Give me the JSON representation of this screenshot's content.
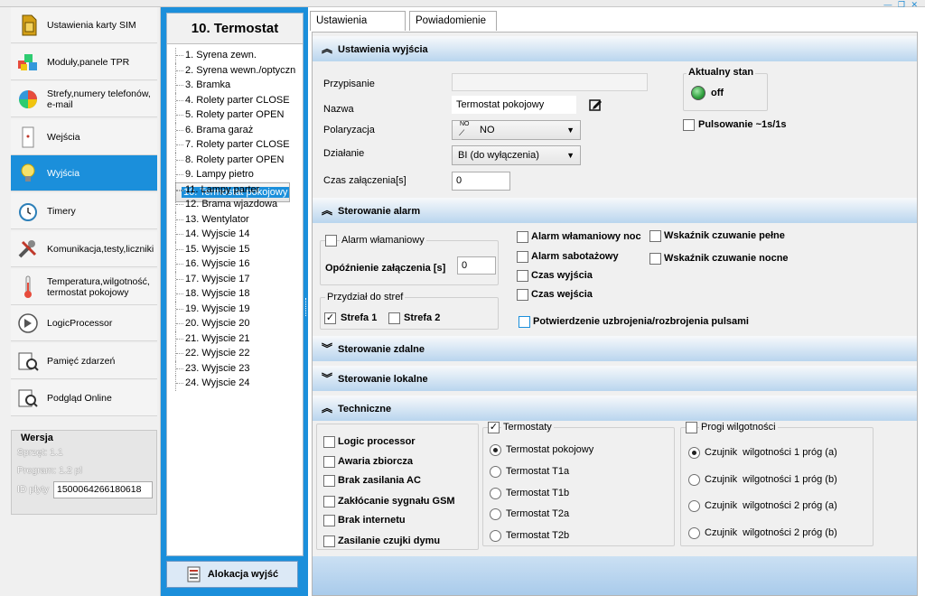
{
  "window": {
    "buttons": "— ❐ ✕"
  },
  "sidebar": {
    "items": [
      {
        "label": "Ustawienia karty SIM",
        "icon": "sim-card-icon"
      },
      {
        "label": "Moduły,panele TPR",
        "icon": "modules-icon"
      },
      {
        "label": "Strefy,numery telefonów, e-mail",
        "icon": "zones-pie-icon"
      },
      {
        "label": "Wejścia",
        "icon": "door-sensor-icon"
      },
      {
        "label": "Wyjścia",
        "icon": "lightbulb-icon"
      },
      {
        "label": "Timery",
        "icon": "alarm-clock-icon"
      },
      {
        "label": "Komunikacja,testy,liczniki",
        "icon": "tools-icon"
      },
      {
        "label": "Temperatura,wilgotność, termostat pokojowy",
        "icon": "thermometer-icon"
      },
      {
        "label": "LogicProcessor",
        "icon": "logic-processor-icon"
      },
      {
        "label": "Pamięć zdarzeń",
        "icon": "event-memory-icon"
      },
      {
        "label": "Podgląd Online",
        "icon": "online-preview-icon"
      }
    ],
    "active_index": 4
  },
  "version": {
    "title": "Wersja",
    "hardware": "Sprzęt: 1.1",
    "program": "Program: 1.2 pl",
    "id_label": "ID płyty",
    "id_value": "1500064266180618"
  },
  "outputs": {
    "title": "10. Termostat",
    "items": [
      "1. Syrena zewn.",
      "2. Syrena wewn./optyczn",
      "3. Bramka",
      "4. Rolety parter CLOSE",
      "5. Rolety parter OPEN",
      "6. Brama garaż",
      "7. Rolety parter CLOSE",
      "8. Rolety parter OPEN",
      "9. Lampy pietro",
      "10. Termostat pokojowy",
      "11. Lampy parter",
      "12. Brama wjazdowa",
      "13. Wentylator",
      "14. Wyjscie 14",
      "15. Wyjscie 15",
      "16. Wyjscie 16",
      "17. Wyjscie 17",
      "18. Wyjscie 18",
      "19. Wyjscie 19",
      "20. Wyjscie 20",
      "21. Wyjscie 21",
      "22. Wyjscie 22",
      "23. Wyjscie 23",
      "24. Wyjscie 24"
    ],
    "selected_index": 9,
    "alloc_button": "Alokacja wyjść"
  },
  "tabs": [
    "Ustawienia wyjścia",
    "Powiadomienie"
  ],
  "settings": {
    "section_title": "Ustawienia wyjścia",
    "przypisanie_label": "Przypisanie",
    "przypisanie_value": "",
    "nazwa_label": "Nazwa",
    "nazwa_value": "Termostat pokojowy",
    "polaryzacja_label": "Polaryzacja",
    "polaryzacja_value": "NO",
    "polaryzacja_icon_text": "NO",
    "dzialanie_label": "Działanie",
    "dzialanie_value": "BI (do wyłączenia)",
    "czas_label": "Czas załączenia[s]",
    "czas_value": "0",
    "aktualny_stan_title": "Aktualny stan",
    "aktualny_stan_value": "off",
    "pulsowanie_label": "Pulsowanie ~1s/1s"
  },
  "alarm": {
    "section_title": "Sterowanie alarm",
    "alarm_wlamaniowy": "Alarm włamaniowy",
    "opoznienie_label": "Opóźnienie  załączenia [s]",
    "opoznienie_value": "0",
    "przydzial_title": "Przydział do stref",
    "strefa1": "Strefa 1",
    "strefa2": "Strefa 2",
    "alarm_noc": "Alarm włamaniowy noc",
    "alarm_sabotaz": "Alarm sabotażowy",
    "czas_wyjscia": "Czas wyjścia",
    "czas_wejscia": "Czas wejścia",
    "wskaznik_pelne": "Wskaźnik czuwanie pełne",
    "wskaznik_nocne": "Wskaźnik czuwanie nocne",
    "potwierdzenie": "Potwierdzenie uzbrojenia/rozbrojenia pulsami"
  },
  "sections": {
    "zdalne": "Sterowanie zdalne",
    "lokalne": "Sterowanie lokalne",
    "techniczne": "Techniczne"
  },
  "technical": {
    "items": [
      "Logic processor",
      "Awaria zbiorcza",
      "Brak zasilania AC",
      "Zakłócanie sygnału GSM",
      "Brak internetu",
      "Zasilanie czujki dymu"
    ],
    "termostaty_title": "Termostaty",
    "termostaty": [
      "Termostat pokojowy",
      "Termostat T1a",
      "Termostat T1b",
      "Termostat T2a",
      "Termostat T2b"
    ],
    "progi_title": "Progi wilgotności",
    "progi": [
      "Czujnik  wilgotności 1 próg (a)",
      "Czujnik  wilgotności 1 próg (b)",
      "Czujnik  wilgotności 2 próg (a)",
      "Czujnik  wilgotności 2 próg (b)"
    ]
  },
  "colors": {
    "accent": "#1b8fdb",
    "section": "#b9d5ee",
    "led": "#2e9e3c"
  }
}
